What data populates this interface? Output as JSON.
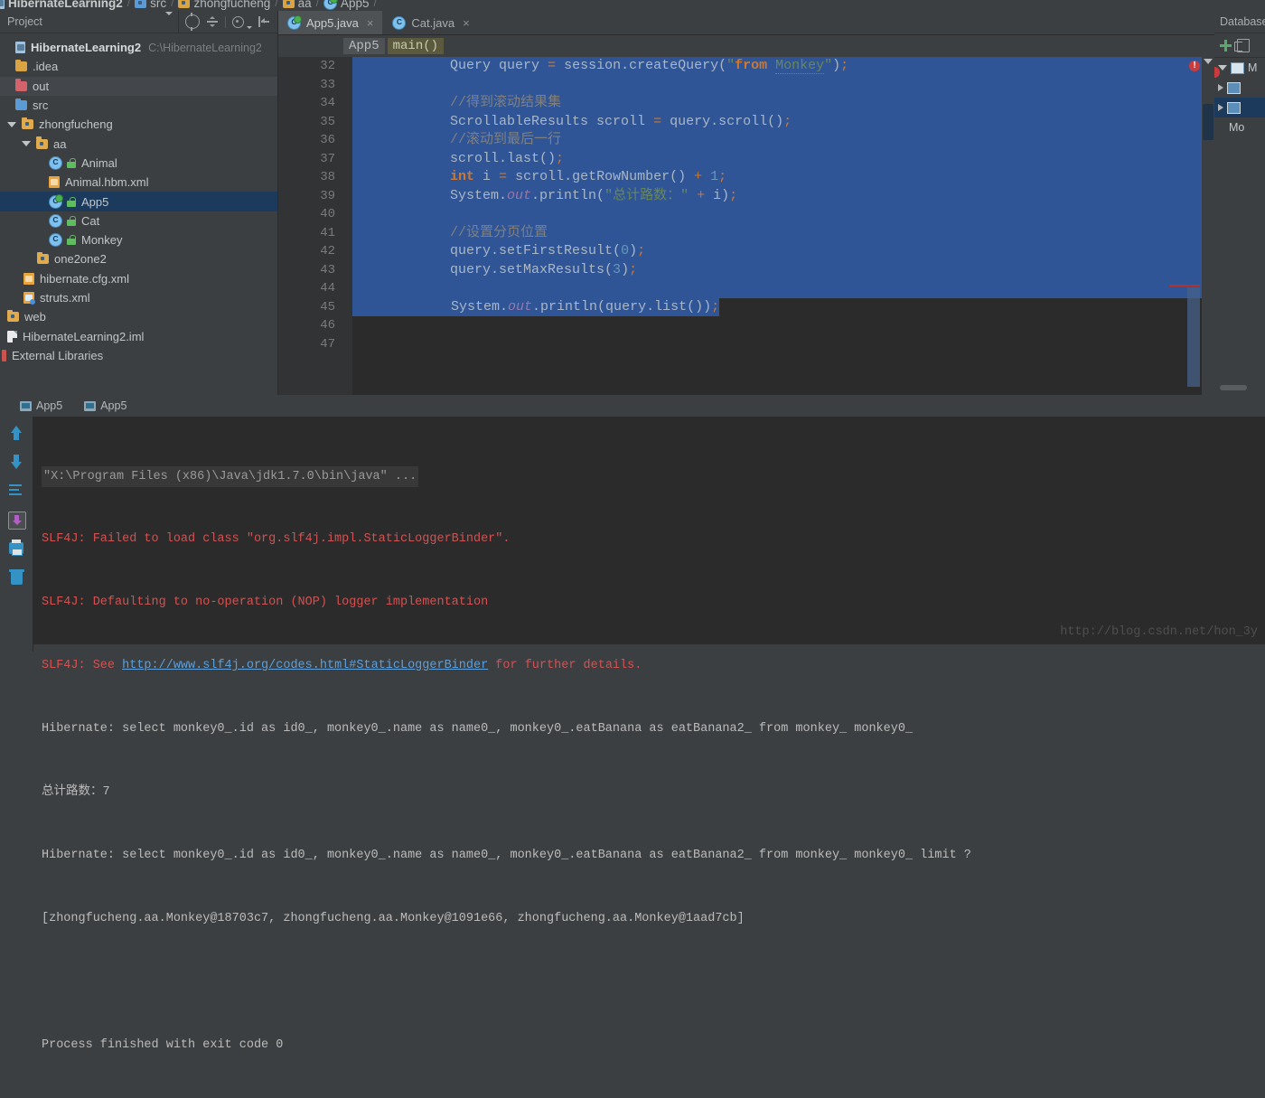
{
  "breadcrumb": {
    "items": [
      {
        "label": "HibernateLearning2",
        "icon": "module-icon",
        "bold": true
      },
      {
        "label": "src",
        "icon": "folder-icon"
      },
      {
        "label": "zhongfucheng",
        "icon": "package-icon"
      },
      {
        "label": "aa",
        "icon": "package-icon"
      },
      {
        "label": "App5",
        "icon": "class-icon"
      }
    ]
  },
  "project_panel": {
    "title": "Project",
    "tools": [
      "locate-icon",
      "collapse-all-icon",
      "settings-gear-icon",
      "hide-panel-icon"
    ],
    "tree": [
      {
        "label": "HibernateLearning2",
        "path": "C:\\HibernateLearning2",
        "icon": "module-icon",
        "indent": 0,
        "bold": true,
        "twisty": ""
      },
      {
        "label": ".idea",
        "icon": "folder-icon",
        "indent": 1,
        "twisty": ""
      },
      {
        "label": "out",
        "icon": "folder-red-icon",
        "indent": 1,
        "twisty": "",
        "hover": true
      },
      {
        "label": "src",
        "icon": "folder-blue-icon",
        "indent": 1,
        "twisty": ""
      },
      {
        "label": "zhongfucheng",
        "icon": "package-icon",
        "indent": 1,
        "twisty": "down"
      },
      {
        "label": "aa",
        "icon": "package-icon",
        "indent": 2,
        "twisty": "down"
      },
      {
        "label": "Animal",
        "icon": "class-icon",
        "indent": 3,
        "twisty": "",
        "lock": true
      },
      {
        "label": "Animal.hbm.xml",
        "icon": "xml-icon",
        "indent": 3,
        "twisty": ""
      },
      {
        "label": "App5",
        "icon": "class-runnable-icon",
        "indent": 3,
        "twisty": "",
        "lock": true,
        "selected": true
      },
      {
        "label": "Cat",
        "icon": "class-icon",
        "indent": 3,
        "twisty": "",
        "lock": true
      },
      {
        "label": "Monkey",
        "icon": "class-icon",
        "indent": 3,
        "twisty": "",
        "lock": true
      },
      {
        "label": "one2one2",
        "icon": "package-icon",
        "indent": 2,
        "twisty": ""
      },
      {
        "label": "hibernate.cfg.xml",
        "icon": "xml-icon",
        "indent": 1,
        "twisty": ""
      },
      {
        "label": "struts.xml",
        "icon": "xml-blue-icon",
        "indent": 1,
        "twisty": ""
      },
      {
        "label": "web",
        "icon": "package-icon",
        "indent": 0,
        "twisty": ""
      },
      {
        "label": "HibernateLearning2.iml",
        "icon": "file-icon",
        "indent": 0,
        "twisty": ""
      },
      {
        "label": "External Libraries",
        "icon": "library-icon",
        "indent": -1,
        "twisty": ""
      }
    ]
  },
  "editor": {
    "tabs": [
      {
        "label": "App5.java",
        "icon": "class-runnable-icon",
        "active": true,
        "close": "×"
      },
      {
        "label": "Cat.java",
        "icon": "class-icon",
        "active": false,
        "close": "×"
      }
    ],
    "breadcrumb": [
      {
        "label": "App5",
        "kind": "class"
      },
      {
        "label": "main()",
        "kind": "method"
      }
    ],
    "first_line_number": 32,
    "line_numbers": [
      32,
      33,
      34,
      35,
      36,
      37,
      38,
      39,
      40,
      41,
      42,
      43,
      44,
      45,
      46,
      47
    ],
    "lines": [
      {
        "n": 32,
        "text": "            Query query = session.createQuery(\"from Monkey\");",
        "selected": true
      },
      {
        "n": 33,
        "text": "",
        "selected": true
      },
      {
        "n": 34,
        "text": "            //得到滚动结果集",
        "selected": true
      },
      {
        "n": 35,
        "text": "            ScrollableResults scroll = query.scroll();",
        "selected": true
      },
      {
        "n": 36,
        "text": "            //滚动到最后一行",
        "selected": true
      },
      {
        "n": 37,
        "text": "            scroll.last();",
        "selected": true
      },
      {
        "n": 38,
        "text": "            int i = scroll.getRowNumber() + 1;",
        "selected": true
      },
      {
        "n": 39,
        "text": "            System.out.println(\"总计路数：\" + i);",
        "selected": true
      },
      {
        "n": 40,
        "text": "",
        "selected": true
      },
      {
        "n": 41,
        "text": "            //设置分页位置",
        "selected": true
      },
      {
        "n": 42,
        "text": "            query.setFirstResult(0);",
        "selected": true
      },
      {
        "n": 43,
        "text": "            query.setMaxResults(3);",
        "selected": true
      },
      {
        "n": 44,
        "text": "",
        "selected": true
      },
      {
        "n": 45,
        "text": "            System.out.println(query.list());",
        "selected": true
      },
      {
        "n": 46,
        "text": "",
        "selected": false
      },
      {
        "n": 47,
        "text": "",
        "selected": false
      }
    ],
    "error_badge": "!"
  },
  "database_panel": {
    "title": "Database",
    "tools": [
      "add-icon",
      "copy-icon"
    ],
    "rows": [
      {
        "label": "M",
        "icon": "datasource-icon",
        "twisty": "down"
      },
      {
        "label": "",
        "icon": "table-icon",
        "twisty": "right"
      },
      {
        "label": "",
        "icon": "table-icon",
        "twisty": "right",
        "selected": true
      },
      {
        "label": "Mo",
        "icon": "",
        "twisty": ""
      }
    ]
  },
  "run_tabs": [
    {
      "label": "App5",
      "icon": "console-icon"
    },
    {
      "label": "App5",
      "icon": "console-icon"
    }
  ],
  "console": {
    "tools": [
      "arrow-up-icon",
      "arrow-down-icon",
      "soft-wrap-icon",
      "scroll-to-end-icon",
      "print-icon",
      "clear-all-icon"
    ],
    "lines": [
      {
        "kind": "dim",
        "text": "\"X:\\Program Files (x86)\\Java\\jdk1.7.0\\bin\\java\" ..."
      },
      {
        "kind": "err",
        "text": "SLF4J: Failed to load class \"org.slf4j.impl.StaticLoggerBinder\"."
      },
      {
        "kind": "err",
        "text": "SLF4J: Defaulting to no-operation (NOP) logger implementation"
      },
      {
        "kind": "err-link",
        "prefix": "SLF4J: See ",
        "link": "http://www.slf4j.org/codes.html#StaticLoggerBinder",
        "suffix": " for further details."
      },
      {
        "kind": "norm",
        "text": "Hibernate: select monkey0_.id as id0_, monkey0_.name as name0_, monkey0_.eatBanana as eatBanana2_ from monkey_ monkey0_"
      },
      {
        "kind": "norm",
        "text": "总计路数：7"
      },
      {
        "kind": "norm",
        "text": "Hibernate: select monkey0_.id as id0_, monkey0_.name as name0_, monkey0_.eatBanana as eatBanana2_ from monkey_ monkey0_ limit ?"
      },
      {
        "kind": "norm",
        "text": "[zhongfucheng.aa.Monkey@18703c7, zhongfucheng.aa.Monkey@1091e66, zhongfucheng.aa.Monkey@1aad7cb]"
      },
      {
        "kind": "blank",
        "text": ""
      },
      {
        "kind": "norm",
        "text": "Process finished with exit code 0"
      }
    ]
  },
  "watermark": "http://blog.csdn.net/hon_3y",
  "colors": {
    "accent_selection": "#2f5597",
    "tree_selection": "#1b3a5c",
    "error_red": "#d25252",
    "link_blue": "#5c9fdb",
    "keyword_orange": "#cc7832",
    "string_green": "#6a8759",
    "number_blue": "#6897bb",
    "comment_gray": "#808080"
  }
}
